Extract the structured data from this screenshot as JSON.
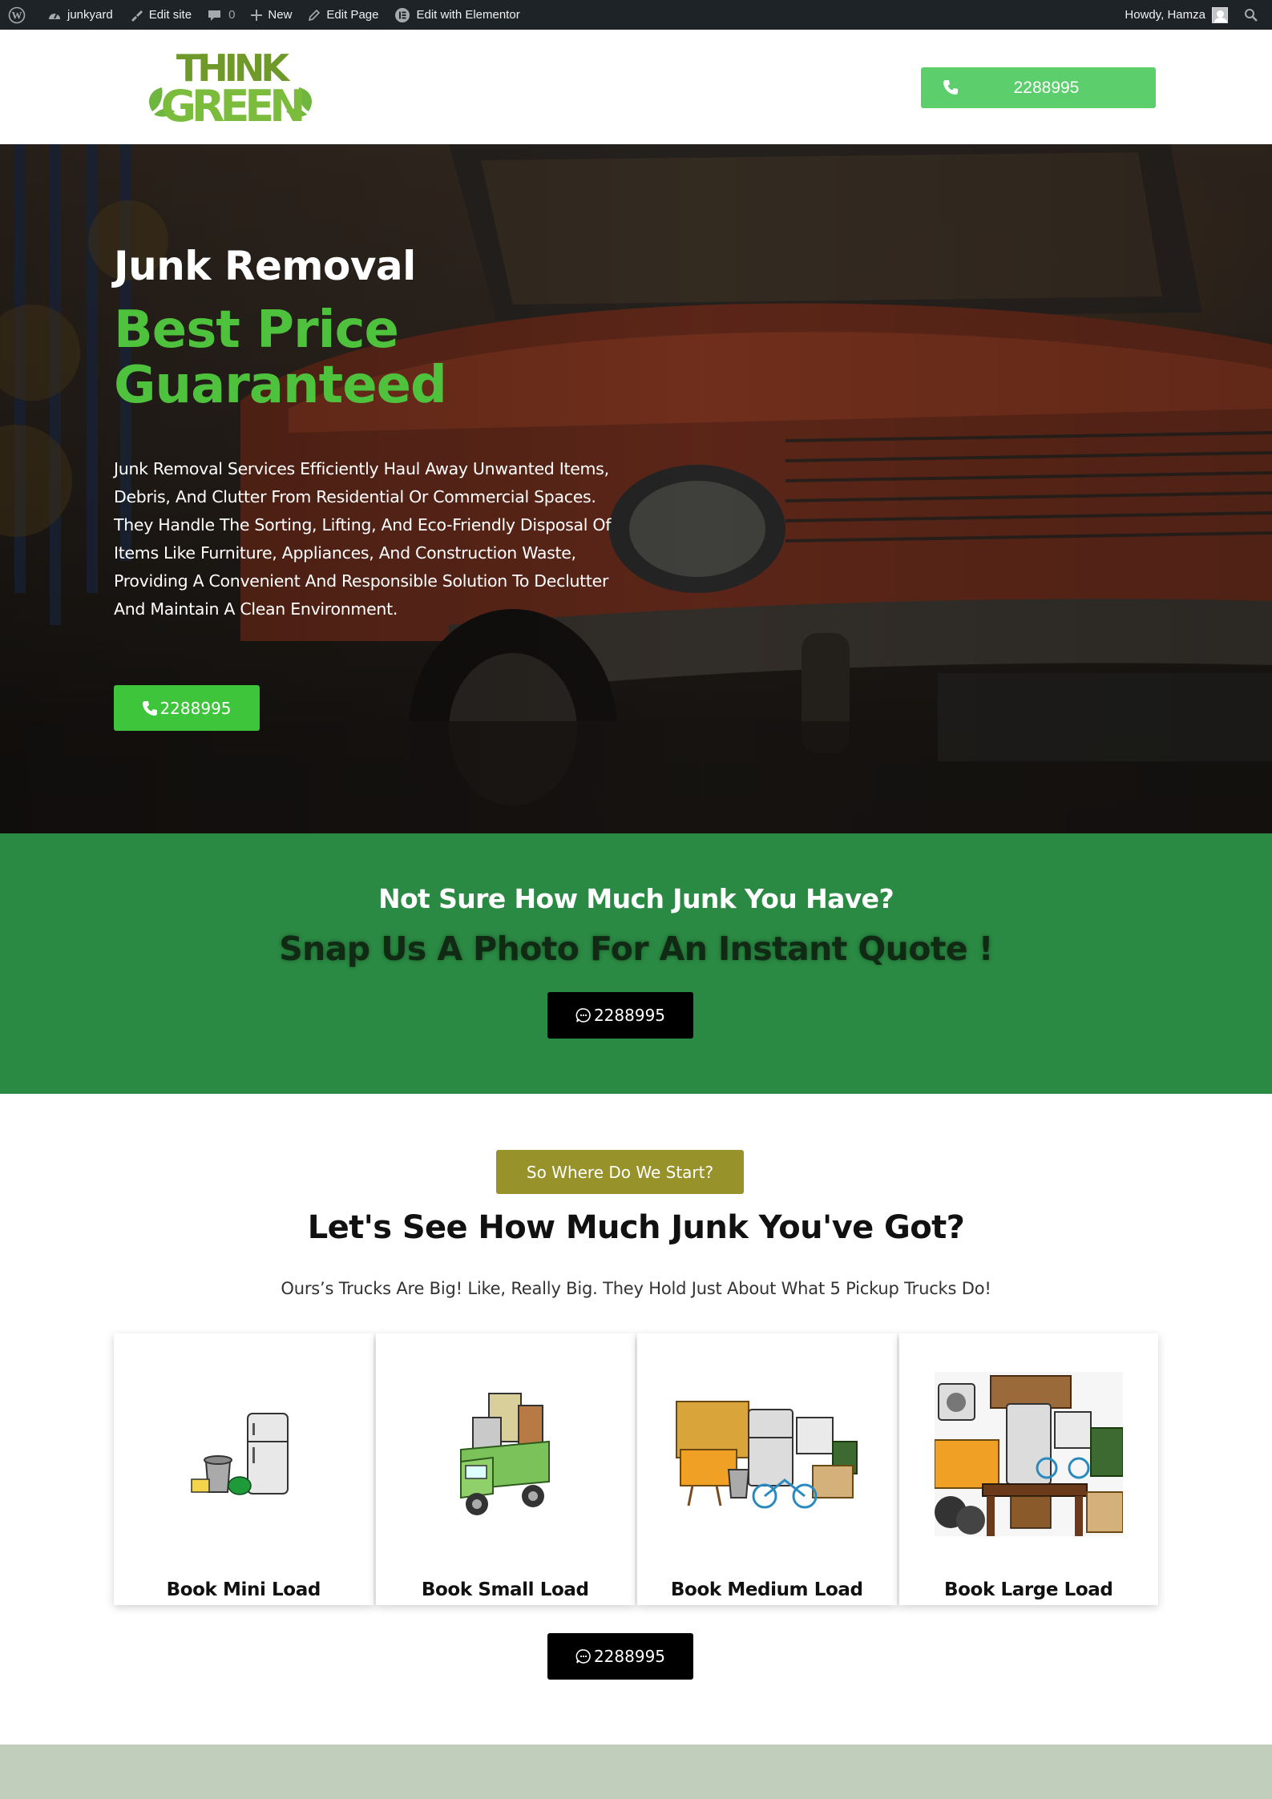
{
  "admin_bar": {
    "site_name": "junkyard",
    "edit_site": "Edit site",
    "comments_count": "0",
    "new_label": "New",
    "edit_page": "Edit Page",
    "edit_elementor": "Edit with Elementor",
    "howdy": "Howdy, Hamza"
  },
  "header": {
    "logo_text_top": "THINK",
    "logo_text_bottom": "GREEN",
    "call_number": "2288995"
  },
  "hero": {
    "title": "Junk Removal",
    "subtitle_line1": "Best Price",
    "subtitle_line2": "Guaranteed",
    "description": "Junk Removal Services Efficiently Haul Away Unwanted Items, Debris, And Clutter From Residential Or Commercial Spaces. They Handle The Sorting, Lifting, And Eco-Friendly Disposal Of Items Like Furniture, Appliances, And Construction Waste, Providing A Convenient And Responsible Solution To Declutter And Maintain A Clean Environment.",
    "button_number": "2288995"
  },
  "quote_band": {
    "heading": "Not Sure How Much Junk You Have?",
    "subheading": "Snap Us A Photo For An Instant Quote !",
    "button_number": "2288995"
  },
  "loads": {
    "pill_label": "So Where Do We Start?",
    "title": "Let's See How Much Junk You've Got?",
    "subtitle": "Ours’s Trucks Are Big! Like, Really Big. They Hold Just About What 5 Pickup Trucks Do!",
    "cards": [
      {
        "label": "Book Mini Load"
      },
      {
        "label": "Book Small Load"
      },
      {
        "label": "Book Medium Load"
      },
      {
        "label": "Book Large Load"
      }
    ],
    "button_number": "2288995"
  },
  "colors": {
    "admin_bar": "#1d2327",
    "header_button": "#5ccf6c",
    "hero_accent": "#4ec23d",
    "hero_button": "#3fc53c",
    "band": "#2a8a43",
    "pill": "#97922a",
    "footer_band": "#c1cebb"
  }
}
